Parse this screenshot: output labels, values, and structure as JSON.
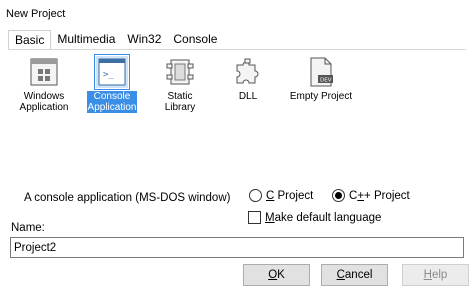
{
  "window": {
    "title": "New Project"
  },
  "tabs": [
    {
      "label": "Basic",
      "active": true
    },
    {
      "label": "Multimedia",
      "active": false
    },
    {
      "label": "Win32",
      "active": false
    },
    {
      "label": "Console",
      "active": false
    }
  ],
  "templates": [
    {
      "line1": "Windows",
      "line2": "Application",
      "icon": "window-icon",
      "selected": false
    },
    {
      "line1": "Console",
      "line2": "Application",
      "icon": "console-icon",
      "selected": true
    },
    {
      "line1": "Static Library",
      "line2": "",
      "icon": "static-library-icon",
      "selected": false
    },
    {
      "line1": "DLL",
      "line2": "",
      "icon": "puzzle-icon",
      "selected": false
    },
    {
      "line1": "Empty Project",
      "line2": "",
      "icon": "empty-project-icon",
      "selected": false
    }
  ],
  "description": "A console application (MS-DOS window)",
  "language": {
    "c_prefix": "C",
    "c_suffix": " Project",
    "cpp_prefix": "C",
    "cpp_underlined": "+",
    "cpp_suffix": "+ Project",
    "selected": "cpp"
  },
  "default_language": {
    "prefix": "",
    "underlined": "M",
    "suffix": "ake default language",
    "checked": false
  },
  "name": {
    "label": "Name:",
    "value": "Project2"
  },
  "buttons": {
    "ok": {
      "underlined": "O",
      "rest": "K"
    },
    "cancel": {
      "underlined": "C",
      "rest": "ancel"
    },
    "help": {
      "underlined": "H",
      "rest": "elp",
      "disabled": true
    }
  },
  "colors": {
    "selection": "#3a8ee6",
    "button_face": "#e1e1e1"
  }
}
